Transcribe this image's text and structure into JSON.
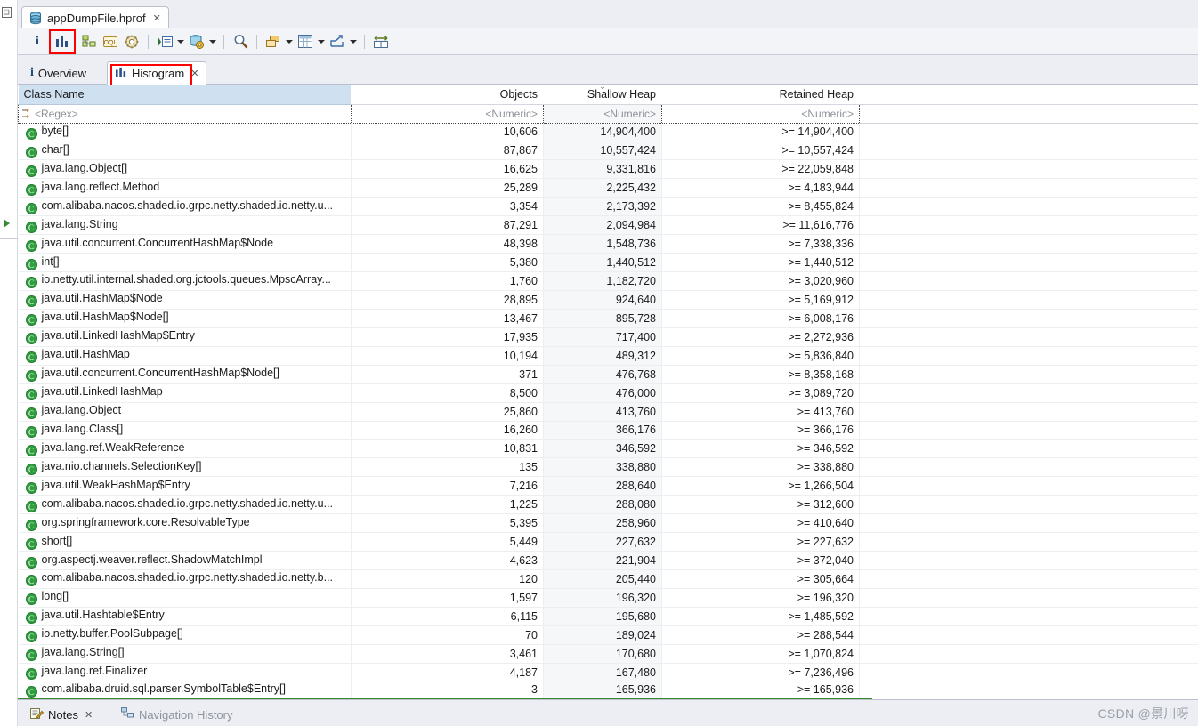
{
  "window": {
    "editor_tab": {
      "label": "appDumpFile.hprof",
      "icon": "heap-dump-icon",
      "close": "✕"
    }
  },
  "toolbar": {
    "items": [
      {
        "name": "overview-info-icon",
        "glyph": "i",
        "has_arrow": false
      },
      {
        "name": "histogram-icon",
        "glyph": "histogram",
        "has_arrow": false,
        "highlighted": true
      },
      {
        "name": "dominator-tree-icon",
        "glyph": "tree",
        "has_arrow": false
      },
      {
        "name": "oql-icon",
        "glyph": "OQL",
        "has_arrow": false
      },
      {
        "name": "thread-overview-icon",
        "glyph": "gear-cog",
        "has_arrow": false
      },
      {
        "name": "run-expert-system-icon",
        "glyph": "run-list",
        "has_arrow": true
      },
      {
        "name": "query-browser-icon",
        "glyph": "db-gear",
        "has_arrow": true
      },
      {
        "name": "find-icon",
        "glyph": "magnifier",
        "has_arrow": false
      },
      {
        "name": "group-by-icon",
        "glyph": "stacked-boxes",
        "has_arrow": true
      },
      {
        "name": "calculator-icon",
        "glyph": "grid",
        "has_arrow": true
      },
      {
        "name": "export-icon",
        "glyph": "export-arrow",
        "has_arrow": true
      },
      {
        "name": "compare-icon",
        "glyph": "compare",
        "has_arrow": false
      }
    ]
  },
  "view_tabs": [
    {
      "label": "Overview",
      "icon": "info-icon",
      "active": false
    },
    {
      "label": "Histogram",
      "icon": "histogram-icon",
      "active": true,
      "close": "✕",
      "highlighted": true
    }
  ],
  "table": {
    "columns": [
      {
        "key": "class_name",
        "label": "Class Name",
        "align": "left",
        "sorted": false
      },
      {
        "key": "objects",
        "label": "Objects",
        "align": "right",
        "sorted": false
      },
      {
        "key": "shallow_heap",
        "label": "Shallow Heap",
        "align": "right",
        "sorted": true,
        "sort_caret": "⌄"
      },
      {
        "key": "retained_heap",
        "label": "Retained Heap",
        "align": "right",
        "sorted": false
      }
    ],
    "filter_row": {
      "class_name": "<Regex>",
      "objects": "<Numeric>",
      "shallow_heap": "<Numeric>",
      "retained_heap": "<Numeric>"
    },
    "rows": [
      {
        "class_name": "byte[]",
        "objects": "10,606",
        "shallow_heap": "14,904,400",
        "retained_heap": ">= 14,904,400"
      },
      {
        "class_name": "char[]",
        "objects": "87,867",
        "shallow_heap": "10,557,424",
        "retained_heap": ">= 10,557,424"
      },
      {
        "class_name": "java.lang.Object[]",
        "objects": "16,625",
        "shallow_heap": "9,331,816",
        "retained_heap": ">= 22,059,848"
      },
      {
        "class_name": "java.lang.reflect.Method",
        "objects": "25,289",
        "shallow_heap": "2,225,432",
        "retained_heap": ">= 4,183,944"
      },
      {
        "class_name": "com.alibaba.nacos.shaded.io.grpc.netty.shaded.io.netty.u...",
        "objects": "3,354",
        "shallow_heap": "2,173,392",
        "retained_heap": ">= 8,455,824"
      },
      {
        "class_name": "java.lang.String",
        "objects": "87,291",
        "shallow_heap": "2,094,984",
        "retained_heap": ">= 11,616,776"
      },
      {
        "class_name": "java.util.concurrent.ConcurrentHashMap$Node",
        "objects": "48,398",
        "shallow_heap": "1,548,736",
        "retained_heap": ">= 7,338,336"
      },
      {
        "class_name": "int[]",
        "objects": "5,380",
        "shallow_heap": "1,440,512",
        "retained_heap": ">= 1,440,512"
      },
      {
        "class_name": "io.netty.util.internal.shaded.org.jctools.queues.MpscArray...",
        "objects": "1,760",
        "shallow_heap": "1,182,720",
        "retained_heap": ">= 3,020,960"
      },
      {
        "class_name": "java.util.HashMap$Node",
        "objects": "28,895",
        "shallow_heap": "924,640",
        "retained_heap": ">= 5,169,912"
      },
      {
        "class_name": "java.util.HashMap$Node[]",
        "objects": "13,467",
        "shallow_heap": "895,728",
        "retained_heap": ">= 6,008,176"
      },
      {
        "class_name": "java.util.LinkedHashMap$Entry",
        "objects": "17,935",
        "shallow_heap": "717,400",
        "retained_heap": ">= 2,272,936"
      },
      {
        "class_name": "java.util.HashMap",
        "objects": "10,194",
        "shallow_heap": "489,312",
        "retained_heap": ">= 5,836,840"
      },
      {
        "class_name": "java.util.concurrent.ConcurrentHashMap$Node[]",
        "objects": "371",
        "shallow_heap": "476,768",
        "retained_heap": ">= 8,358,168"
      },
      {
        "class_name": "java.util.LinkedHashMap",
        "objects": "8,500",
        "shallow_heap": "476,000",
        "retained_heap": ">= 3,089,720"
      },
      {
        "class_name": "java.lang.Object",
        "objects": "25,860",
        "shallow_heap": "413,760",
        "retained_heap": ">= 413,760"
      },
      {
        "class_name": "java.lang.Class[]",
        "objects": "16,260",
        "shallow_heap": "366,176",
        "retained_heap": ">= 366,176"
      },
      {
        "class_name": "java.lang.ref.WeakReference",
        "objects": "10,831",
        "shallow_heap": "346,592",
        "retained_heap": ">= 346,592"
      },
      {
        "class_name": "java.nio.channels.SelectionKey[]",
        "objects": "135",
        "shallow_heap": "338,880",
        "retained_heap": ">= 338,880"
      },
      {
        "class_name": "java.util.WeakHashMap$Entry",
        "objects": "7,216",
        "shallow_heap": "288,640",
        "retained_heap": ">= 1,266,504"
      },
      {
        "class_name": "com.alibaba.nacos.shaded.io.grpc.netty.shaded.io.netty.u...",
        "objects": "1,225",
        "shallow_heap": "288,080",
        "retained_heap": ">= 312,600"
      },
      {
        "class_name": "org.springframework.core.ResolvableType",
        "objects": "5,395",
        "shallow_heap": "258,960",
        "retained_heap": ">= 410,640"
      },
      {
        "class_name": "short[]",
        "objects": "5,449",
        "shallow_heap": "227,632",
        "retained_heap": ">= 227,632"
      },
      {
        "class_name": "org.aspectj.weaver.reflect.ShadowMatchImpl",
        "objects": "4,623",
        "shallow_heap": "221,904",
        "retained_heap": ">= 372,040"
      },
      {
        "class_name": "com.alibaba.nacos.shaded.io.grpc.netty.shaded.io.netty.b...",
        "objects": "120",
        "shallow_heap": "205,440",
        "retained_heap": ">= 305,664"
      },
      {
        "class_name": "long[]",
        "objects": "1,597",
        "shallow_heap": "196,320",
        "retained_heap": ">= 196,320"
      },
      {
        "class_name": "java.util.Hashtable$Entry",
        "objects": "6,115",
        "shallow_heap": "195,680",
        "retained_heap": ">= 1,485,592"
      },
      {
        "class_name": "io.netty.buffer.PoolSubpage[]",
        "objects": "70",
        "shallow_heap": "189,024",
        "retained_heap": ">= 288,544"
      },
      {
        "class_name": "java.lang.String[]",
        "objects": "3,461",
        "shallow_heap": "170,680",
        "retained_heap": ">= 1,070,824"
      },
      {
        "class_name": "java.lang.ref.Finalizer",
        "objects": "4,187",
        "shallow_heap": "167,480",
        "retained_heap": ">= 7,236,496"
      },
      {
        "class_name": "com.alibaba.druid.sql.parser.SymbolTable$Entry[]",
        "objects": "3",
        "shallow_heap": "165,936",
        "retained_heap": ">= 165,936"
      }
    ]
  },
  "bottom_tabs": [
    {
      "label": "Notes",
      "icon": "notes-icon",
      "active": true,
      "close": "✕"
    },
    {
      "label": "Navigation History",
      "icon": "navigation-history-icon",
      "active": false
    }
  ],
  "watermark": "CSDN @景川呀",
  "colors": {
    "header_blue": "#cfe0f0",
    "highlight_red": "#ff0000",
    "class_icon_green": "#2e9e3e",
    "accent_underline": "#3a8a32"
  }
}
